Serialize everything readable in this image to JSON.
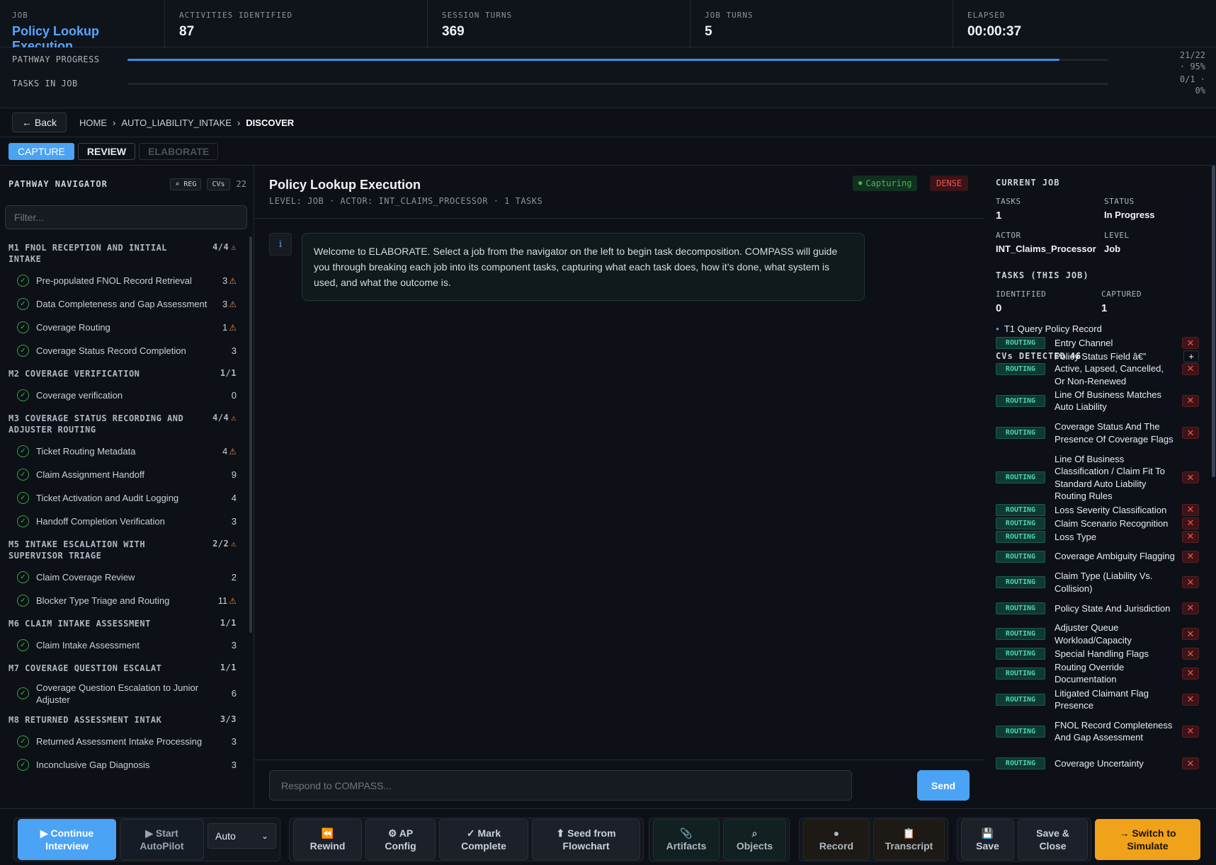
{
  "topbar": {
    "job_label": "JOB",
    "job_value": "Policy Lookup Execution",
    "activities_label": "ACTIVITIES IDENTIFIED",
    "activities_value": "87",
    "session_label": "SESSION TURNS",
    "session_value": "369",
    "jobturns_label": "JOB TURNS",
    "jobturns_value": "5",
    "elapsed_label": "ELAPSED",
    "elapsed_value": "00:00:37"
  },
  "progress": {
    "pathway_label": "PATHWAY PROGRESS",
    "pathway_value_1": "21/22",
    "pathway_value_2": "· 95%",
    "pathway_fraction": 0.95,
    "tasks_label": "TASKS IN JOB",
    "tasks_value_1": "0/1 ·",
    "tasks_value_2": "0%",
    "tasks_fraction": 0
  },
  "breadcrumb": {
    "back_label": "← Back",
    "home": "HOME",
    "sep": "›",
    "project": "AUTO_LIABILITY_INTAKE",
    "current": "DISCOVER"
  },
  "phases": {
    "capture": "CAPTURE",
    "review": "REVIEW",
    "elaborate": "ELABORATE"
  },
  "navigator": {
    "title": "PATHWAY NAVIGATOR",
    "reg_chip": "⌕ REG",
    "cvs_chip": "CVs",
    "cvs_count": "22",
    "filter_placeholder": "Filter...",
    "modules": [
      {
        "title": "M1 FNOL RECEPTION AND INITIAL INTAKE",
        "count": "4/4",
        "warn": true,
        "tasks": [
          {
            "name": "Pre-populated FNOL Record Retrieval",
            "count": "3",
            "warn": true
          },
          {
            "name": "Data Completeness and Gap Assessment",
            "count": "3",
            "warn": true
          },
          {
            "name": "Coverage Routing",
            "count": "1",
            "warn": true
          },
          {
            "name": "Coverage Status Record Completion",
            "count": "3",
            "warn": false
          }
        ]
      },
      {
        "title": "M2 COVERAGE VERIFICATION",
        "count": "1/1",
        "warn": false,
        "tasks": [
          {
            "name": "Coverage verification",
            "count": "0",
            "warn": false
          }
        ]
      },
      {
        "title": "M3 COVERAGE STATUS RECORDING AND ADJUSTER ROUTING",
        "count": "4/4",
        "warn": true,
        "tasks": [
          {
            "name": "Ticket Routing Metadata",
            "count": "4",
            "warn": true
          },
          {
            "name": "Claim Assignment Handoff",
            "count": "9",
            "warn": false
          },
          {
            "name": "Ticket Activation and Audit Logging",
            "count": "4",
            "warn": false
          },
          {
            "name": "Handoff Completion Verification",
            "count": "3",
            "warn": false
          }
        ]
      },
      {
        "title": "M5 INTAKE ESCALATION WITH SUPERVISOR TRIAGE",
        "count": "2/2",
        "warn": true,
        "tasks": [
          {
            "name": "Claim Coverage Review",
            "count": "2",
            "warn": false
          },
          {
            "name": "Blocker Type Triage and Routing",
            "count": "11",
            "warn": true
          }
        ]
      },
      {
        "title": "M6 CLAIM INTAKE ASSESSMENT",
        "count": "1/1",
        "warn": false,
        "tasks": [
          {
            "name": "Claim Intake Assessment",
            "count": "3",
            "warn": false
          }
        ]
      },
      {
        "title": "M7 COVERAGE QUESTION ESCALAT",
        "count": "1/1",
        "warn": false,
        "tasks": [
          {
            "name": "Coverage Question Escalation to Junior Adjuster",
            "count": "6",
            "warn": false
          }
        ]
      },
      {
        "title": "M8 RETURNED ASSESSMENT INTAK",
        "count": "3/3",
        "warn": false,
        "tasks": [
          {
            "name": "Returned Assessment Intake Processing",
            "count": "3",
            "warn": false
          },
          {
            "name": "Inconclusive Gap Diagnosis",
            "count": "3",
            "warn": false
          }
        ]
      }
    ]
  },
  "main": {
    "title": "Policy Lookup Execution",
    "meta": "LEVEL: JOB · ACTOR: INT_CLAIMS_PROCESSOR · 1 TASKS",
    "status_badge": "Capturing",
    "density_badge": "DENSE",
    "message": "Welcome to ELABORATE. Select a job from the navigator on the left to begin task decomposition. COMPASS will guide you through breaking each job into its component tasks, capturing what each task does, how it’s done, what system is used, and what the outcome is.",
    "input_placeholder": "Respond to COMPASS...",
    "send_label": "Send"
  },
  "rightpanel": {
    "current_job": "CURRENT JOB",
    "tasks_label": "TASKS",
    "tasks_value": "1",
    "status_label": "STATUS",
    "status_value": "In Progress",
    "actor_label": "ACTOR",
    "actor_value": "INT_Claims_Processor",
    "level_label": "LEVEL",
    "level_value": "Job",
    "tasks_this_job": "TASKS (THIS JOB)",
    "identified_label": "IDENTIFIED",
    "identified_value": "0",
    "captured_label": "CAPTURED",
    "captured_value": "1",
    "task_item": "T1 Query Policy Record",
    "cvs_label": "CVs DETECTED",
    "cvs_count": "46",
    "tag": "ROUTING",
    "cvs": [
      "Entry Channel",
      "Policy Status Field â€” Active, Lapsed, Cancelled, Or Non-Renewed",
      "Line Of Business Matches Auto Liability",
      "Coverage Status And The Presence Of Coverage Flags",
      "Line Of Business Classification / Claim Fit To Standard Auto Liability Routing Rules",
      "Loss Severity Classification",
      "Claim Scenario Recognition",
      "Loss Type",
      "Coverage Ambiguity Flagging",
      "Claim Type (Liability Vs. Collision)",
      "Policy State And Jurisdiction",
      "Adjuster Queue Workload/Capacity",
      "Special Handling Flags",
      "Routing Override Documentation",
      "Litigated Claimant Flag Presence",
      "FNOL Record Completeness And Gap Assessment",
      "Coverage Uncertainty"
    ]
  },
  "footer": {
    "continue": [
      "▶ Continue",
      "Interview"
    ],
    "autopilot": [
      "▶ Start",
      "AutoPilot"
    ],
    "mode": "Auto",
    "rewind": [
      "⏪",
      "Rewind"
    ],
    "apconfig": [
      "⚙ AP",
      "Config"
    ],
    "mark": [
      "✓ Mark",
      "Complete"
    ],
    "seed": [
      "⬆ Seed from",
      "Flowchart"
    ],
    "artifacts": [
      "📎",
      "Artifacts"
    ],
    "objects": [
      "⌕",
      "Objects"
    ],
    "record": [
      "●",
      "Record"
    ],
    "transcript": [
      "📋",
      "Transcript"
    ],
    "save": [
      "💾",
      "Save"
    ],
    "saveclose": [
      "Save &",
      "Close"
    ],
    "switch": [
      "→ Switch to",
      "Simulate"
    ]
  }
}
